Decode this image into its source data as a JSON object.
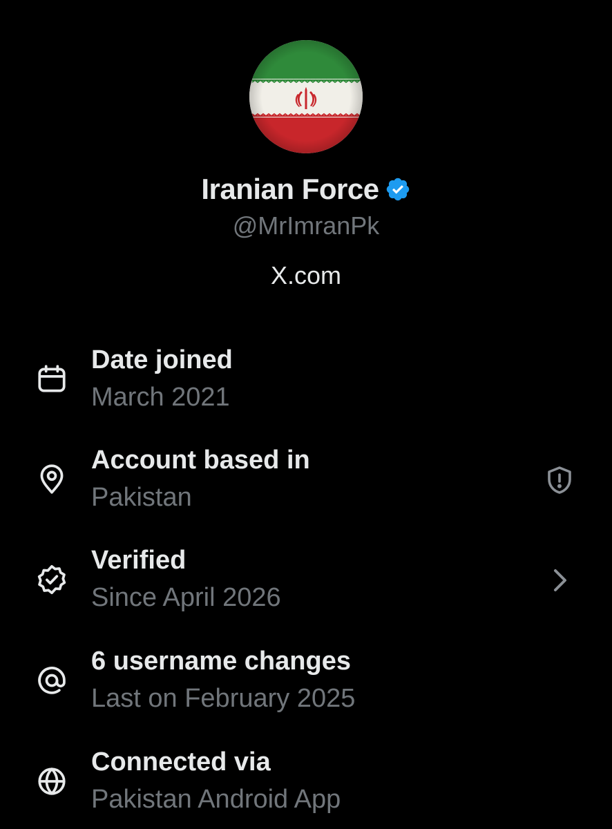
{
  "profile": {
    "display_name": "Iranian Force",
    "handle": "@MrImranPk",
    "site": "X.com",
    "verified": true,
    "badge_color": "#1d9bf0",
    "avatar_icon": "iran-flag-avatar",
    "avatar_colors": {
      "green": "#2f8a3a",
      "white": "#f1efe8",
      "red": "#c8262b"
    }
  },
  "info_rows": [
    {
      "icon": "calendar-icon",
      "title": "Date joined",
      "subtitle": "March 2021",
      "trailing": null
    },
    {
      "icon": "location-pin-icon",
      "title": "Account based in",
      "subtitle": "Pakistan",
      "trailing": "shield-alert-icon"
    },
    {
      "icon": "verified-badge-outline-icon",
      "title": "Verified",
      "subtitle": "Since April 2026",
      "trailing": "chevron-right-icon"
    },
    {
      "icon": "at-sign-icon",
      "title": "6 username changes",
      "subtitle": "Last on February 2025",
      "trailing": null
    },
    {
      "icon": "globe-icon",
      "title": "Connected via",
      "subtitle": "Pakistan Android App",
      "trailing": null
    }
  ],
  "colors": {
    "background": "#000000",
    "primary_text": "#e7e9ea",
    "secondary_text": "#71767b",
    "icon": "#e7e9ea",
    "muted_icon": "#8b9096"
  }
}
